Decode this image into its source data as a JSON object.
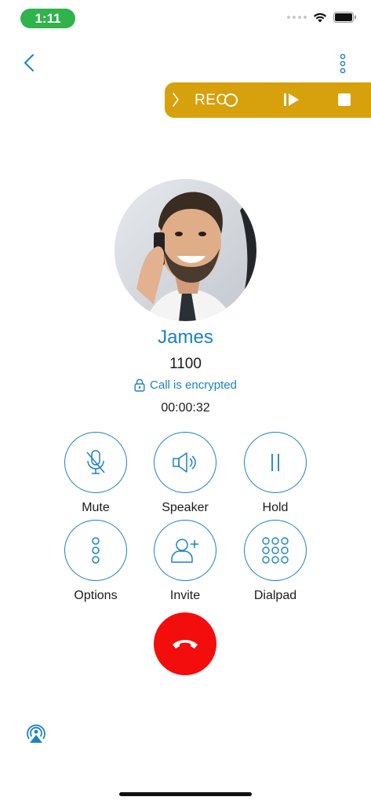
{
  "status_bar": {
    "time": "1:11"
  },
  "rec_bar": {
    "label": "REC",
    "accent": "#d6a10c"
  },
  "caller": {
    "name": "James",
    "number": "1100",
    "encryption": "Call is encrypted",
    "duration": "00:00:32"
  },
  "actions": [
    {
      "label": "Mute",
      "icon": "mic-off-icon"
    },
    {
      "label": "Speaker",
      "icon": "speaker-icon"
    },
    {
      "label": "Hold",
      "icon": "pause-icon"
    },
    {
      "label": "Options",
      "icon": "vertical-dots-icon"
    },
    {
      "label": "Invite",
      "icon": "add-person-icon"
    },
    {
      "label": "Dialpad",
      "icon": "dialpad-icon"
    }
  ],
  "colors": {
    "primary": "#1b82c5",
    "end_call": "#f40d0d",
    "status_green": "#2fb34a"
  }
}
